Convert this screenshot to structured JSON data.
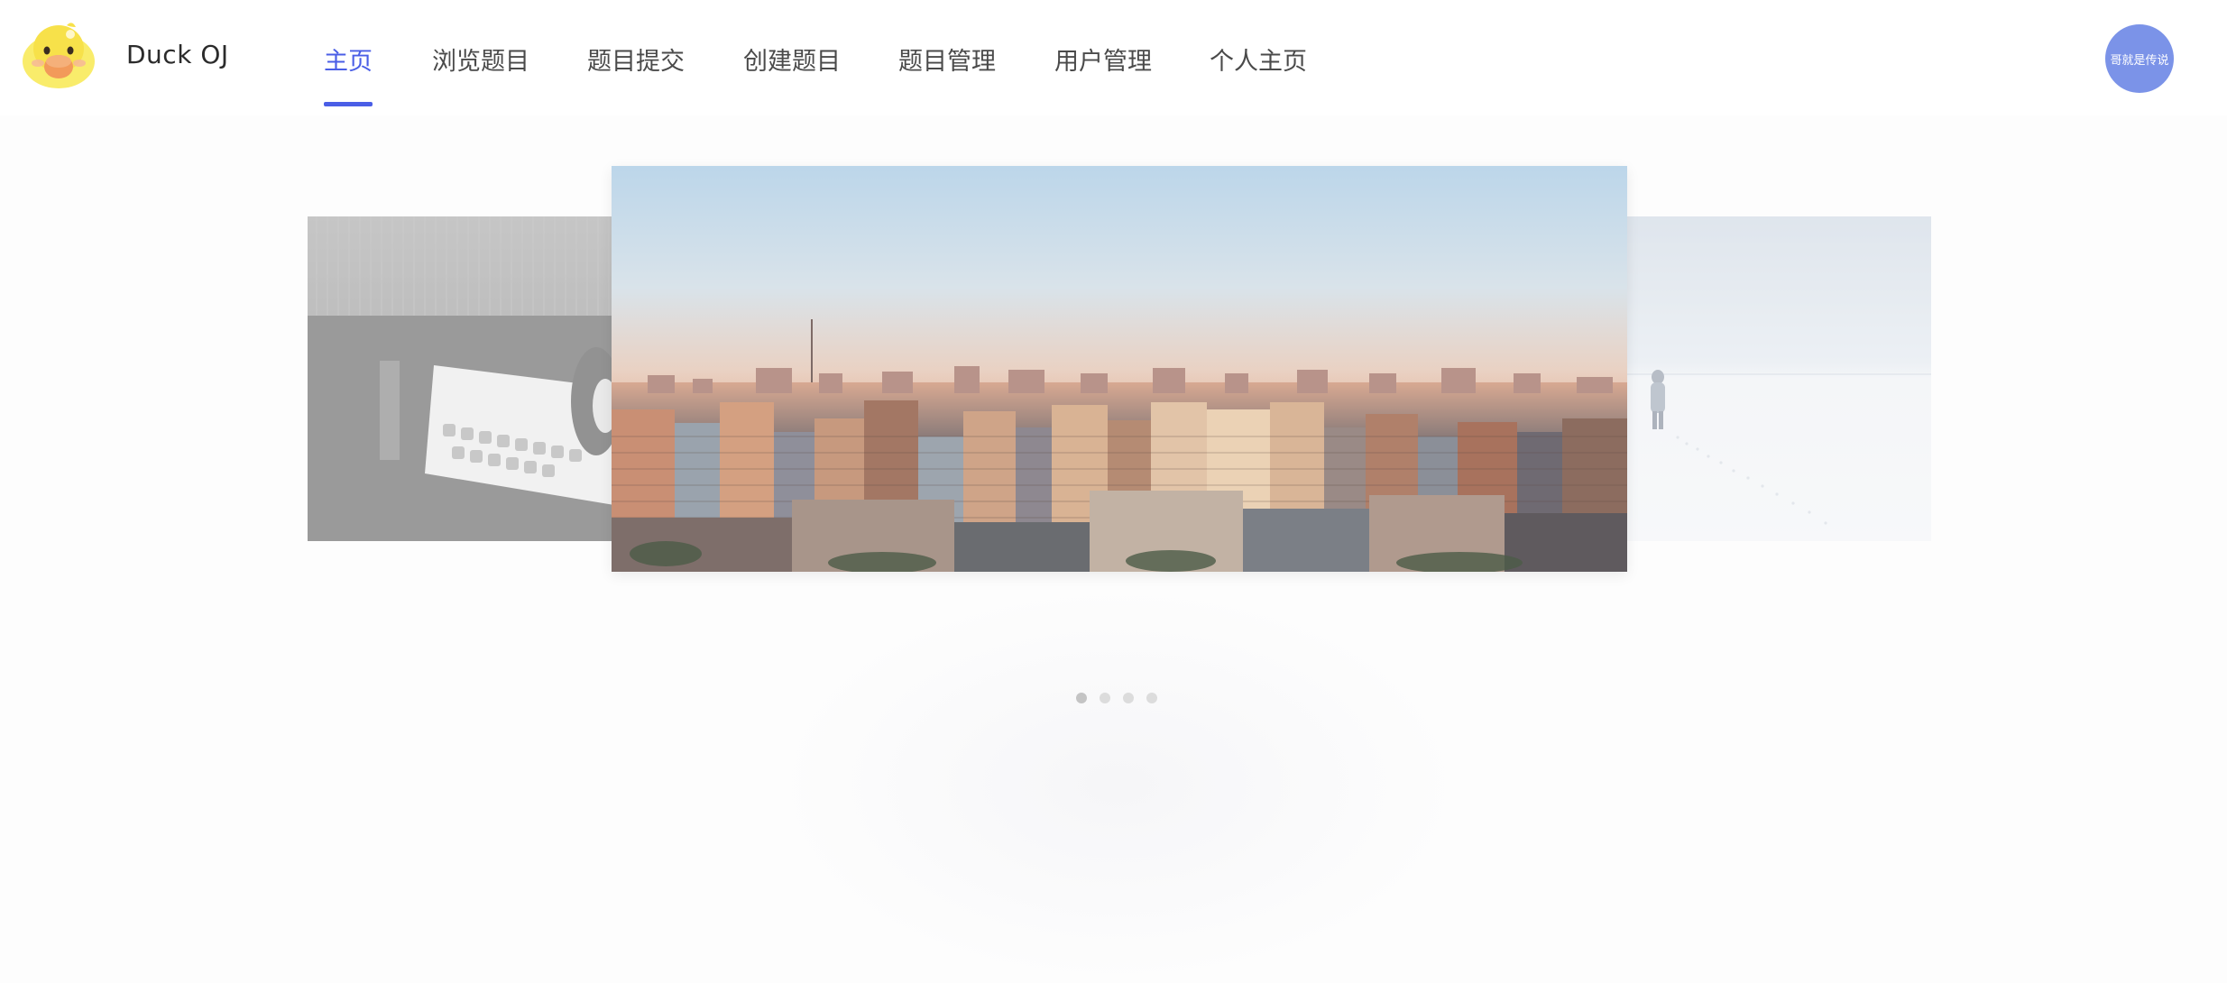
{
  "header": {
    "brand": "Duck OJ",
    "nav": [
      {
        "label": "主页",
        "active": true
      },
      {
        "label": "浏览题目",
        "active": false
      },
      {
        "label": "题目提交",
        "active": false
      },
      {
        "label": "创建题目",
        "active": false
      },
      {
        "label": "题目管理",
        "active": false
      },
      {
        "label": "用户管理",
        "active": false
      },
      {
        "label": "个人主页",
        "active": false
      }
    ],
    "user": {
      "name": "哥就是传说"
    },
    "accent_color": "#4a5ee6",
    "avatar_color": "#7b93e8"
  },
  "carousel": {
    "slides": [
      {
        "name": "keyboard-photo",
        "position": "previous"
      },
      {
        "name": "city-skyline-photo",
        "position": "current"
      },
      {
        "name": "snowfield-photo",
        "position": "next"
      }
    ],
    "indicator_count": 4,
    "active_index": 0
  }
}
